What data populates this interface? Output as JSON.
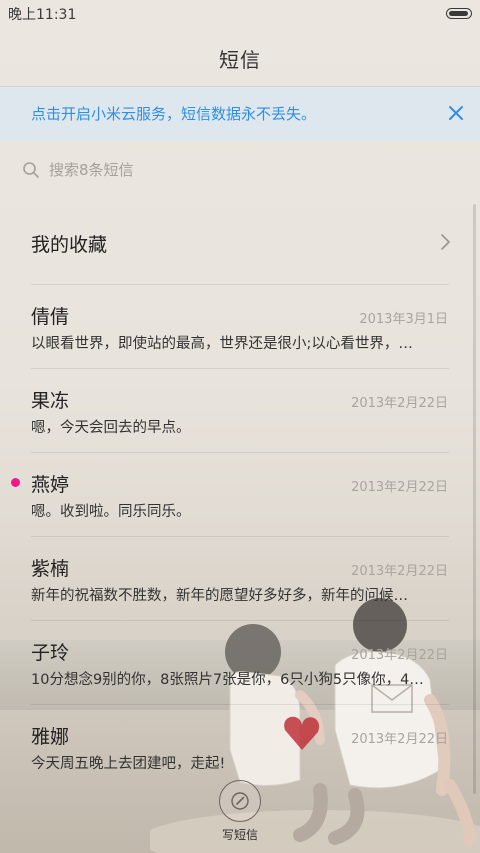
{
  "status_bar": {
    "time": "晚上11:31",
    "battery_icon": "battery-icon"
  },
  "header": {
    "title": "短信"
  },
  "cloud_banner": {
    "text": "点击开启小米云服务，短信数据永不丢失。",
    "close_icon": "close-icon",
    "accent_color": "#2f8fe0"
  },
  "search": {
    "placeholder": "搜索8条短信",
    "icon": "search-icon"
  },
  "favorites": {
    "label": "我的收藏",
    "icon": "chevron-right-icon"
  },
  "messages": [
    {
      "name": "倩倩",
      "date": "2013年3月1日",
      "preview": "以眼看世界，即使站的最高，世界还是很小;以心看世界，…",
      "unread": false
    },
    {
      "name": "果冻",
      "date": "2013年2月22日",
      "preview": "嗯，今天会回去的早点。",
      "unread": false
    },
    {
      "name": "燕婷",
      "date": "2013年2月22日",
      "preview": "嗯。收到啦。同乐同乐。",
      "unread": true
    },
    {
      "name": "紫楠",
      "date": "2013年2月22日",
      "preview": "新年的祝福数不胜数，新年的愿望好多好多，新年的问候…",
      "unread": false
    },
    {
      "name": "子玲",
      "date": "2013年2月22日",
      "preview": "10分想念9别的你，8张照片7张是你，6只小狗5只像你，4…",
      "unread": false
    },
    {
      "name": "雅娜",
      "date": "2013年2月22日",
      "preview": "今天周五晚上去团建吧，走起!",
      "unread": false
    }
  ],
  "compose": {
    "label": "写短信",
    "icon": "compose-icon"
  },
  "colors": {
    "unread_dot": "#f0188c",
    "date_text": "#a9a49d"
  }
}
